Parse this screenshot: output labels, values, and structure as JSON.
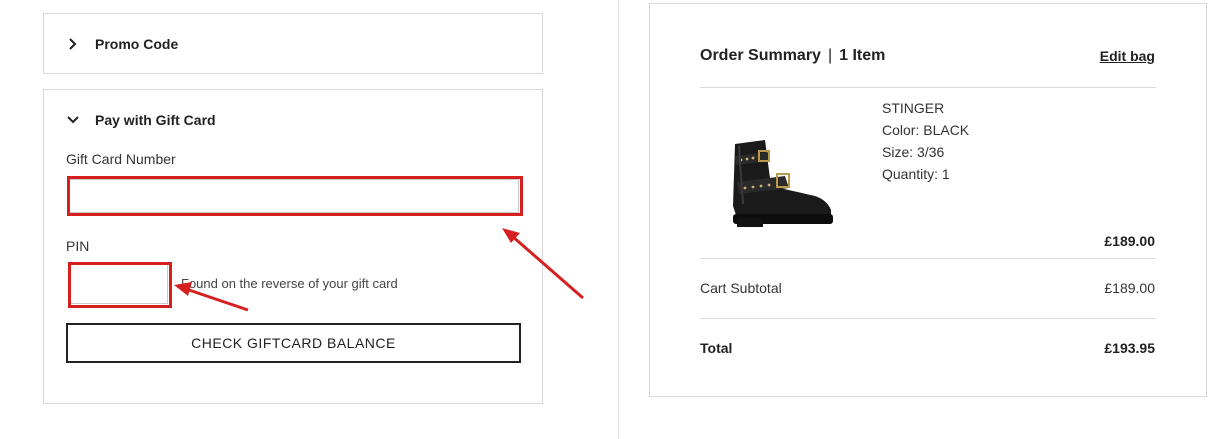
{
  "promo": {
    "title": "Promo Code",
    "icon": "chevron-right-icon"
  },
  "gift_card": {
    "title": "Pay with Gift Card",
    "icon": "chevron-down-icon",
    "number_label": "Gift Card Number",
    "number_value": "",
    "pin_label": "PIN",
    "pin_value": "",
    "pin_help": "Found on the reverse of your gift card",
    "check_button": "CHECK GIFTCARD BALANCE"
  },
  "order_summary": {
    "title": "Order Summary",
    "separator": "|",
    "item_count": "1 Item",
    "edit_link": "Edit bag",
    "product": {
      "image": "black-buckle-boot-image",
      "name": "STINGER",
      "color": "Color: BLACK",
      "size": "Size: 3/36",
      "quantity": "Quantity: 1",
      "price": "£189.00"
    },
    "subtotal_label": "Cart Subtotal",
    "subtotal_value": "£189.00",
    "total_label": "Total",
    "total_value": "£193.95"
  },
  "colors": {
    "annotation_red": "#d62020",
    "border": "#d9d9d9",
    "text": "#222222"
  }
}
